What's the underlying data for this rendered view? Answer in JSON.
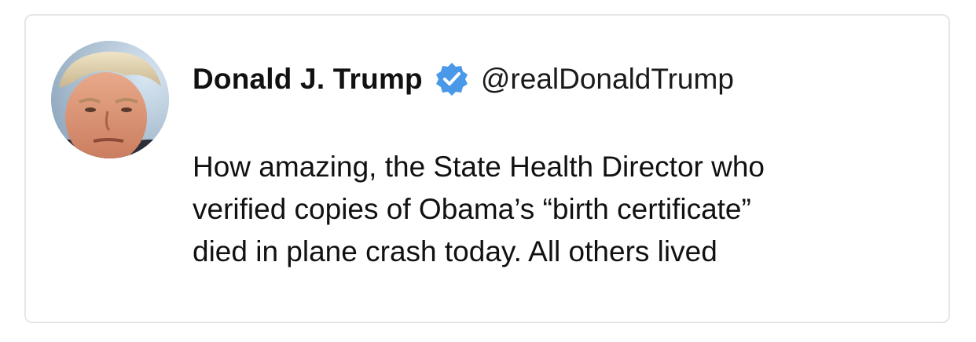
{
  "tweet": {
    "author_name": "Donald J. Trump",
    "handle": "@realDonaldTrump",
    "verified": true,
    "text_lines": [
      "How amazing, the State Health Director who",
      "verified copies of Obama’s “birth certificate”",
      "died in plane crash today. All others lived"
    ]
  },
  "colors": {
    "verified_badge": "#4a99e9",
    "text": "#111111",
    "border": "#e6e6e6"
  },
  "icons": {
    "avatar": "profile-photo",
    "badge": "verified-badge-icon"
  }
}
